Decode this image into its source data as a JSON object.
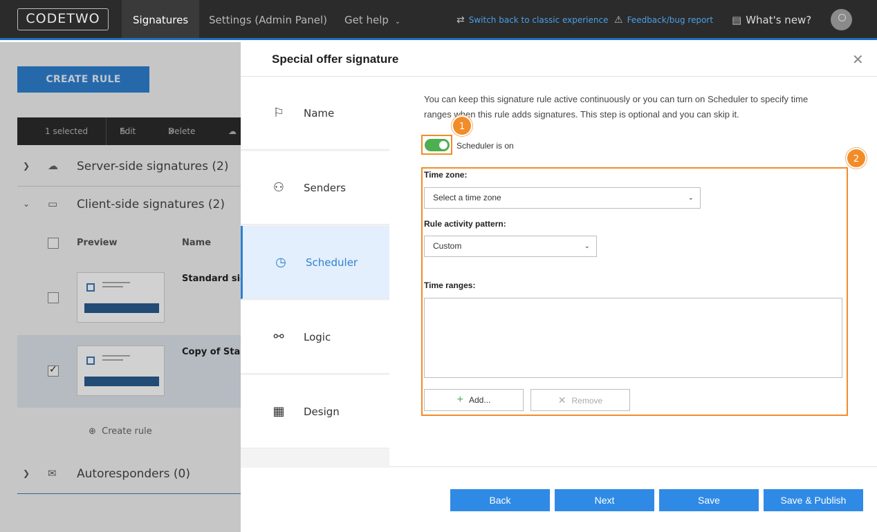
{
  "app": {
    "logo_text": "CODETWO",
    "nav": [
      "Signatures",
      "Settings (Admin Panel)",
      "Get help"
    ],
    "switch_link": "Switch back to classic experience",
    "feedback_link": "Feedback/bug report",
    "whats_new": "What's new?"
  },
  "background": {
    "create_rule": "CREATE RULE",
    "toolbar": {
      "selected": "1 selected",
      "edit": "Edit",
      "delete": "Delete"
    },
    "groups": [
      "Server-side signatures (2)",
      "Client-side signatures (2)",
      "Autoresponders (0)"
    ],
    "columns": {
      "preview": "Preview",
      "name": "Name"
    },
    "rows": [
      "Standard sign",
      "Copy of Stan"
    ],
    "create_rule_small": "Create rule"
  },
  "panel": {
    "title": "Special offer signature",
    "steps": [
      "Name",
      "Senders",
      "Scheduler",
      "Logic",
      "Design"
    ],
    "intro": "You can keep this signature rule active continuously or you can turn on Scheduler to specify time ranges when this rule adds signatures. This step is optional and you can skip it.",
    "toggle_label": "Scheduler is on",
    "badges": [
      "1",
      "2"
    ],
    "time_zone_label": "Time zone:",
    "time_zone_value": "Select a time zone",
    "pattern_label": "Rule activity pattern:",
    "pattern_value": "Custom",
    "ranges_label": "Time ranges:",
    "add_label": "Add...",
    "remove_label": "Remove",
    "buttons": {
      "back": "Back",
      "next": "Next",
      "save": "Save",
      "publish": "Save & Publish"
    }
  },
  "colors": {
    "accent": "#2f80d1",
    "highlight": "#f28c28",
    "toggle_on": "#4caf50"
  }
}
